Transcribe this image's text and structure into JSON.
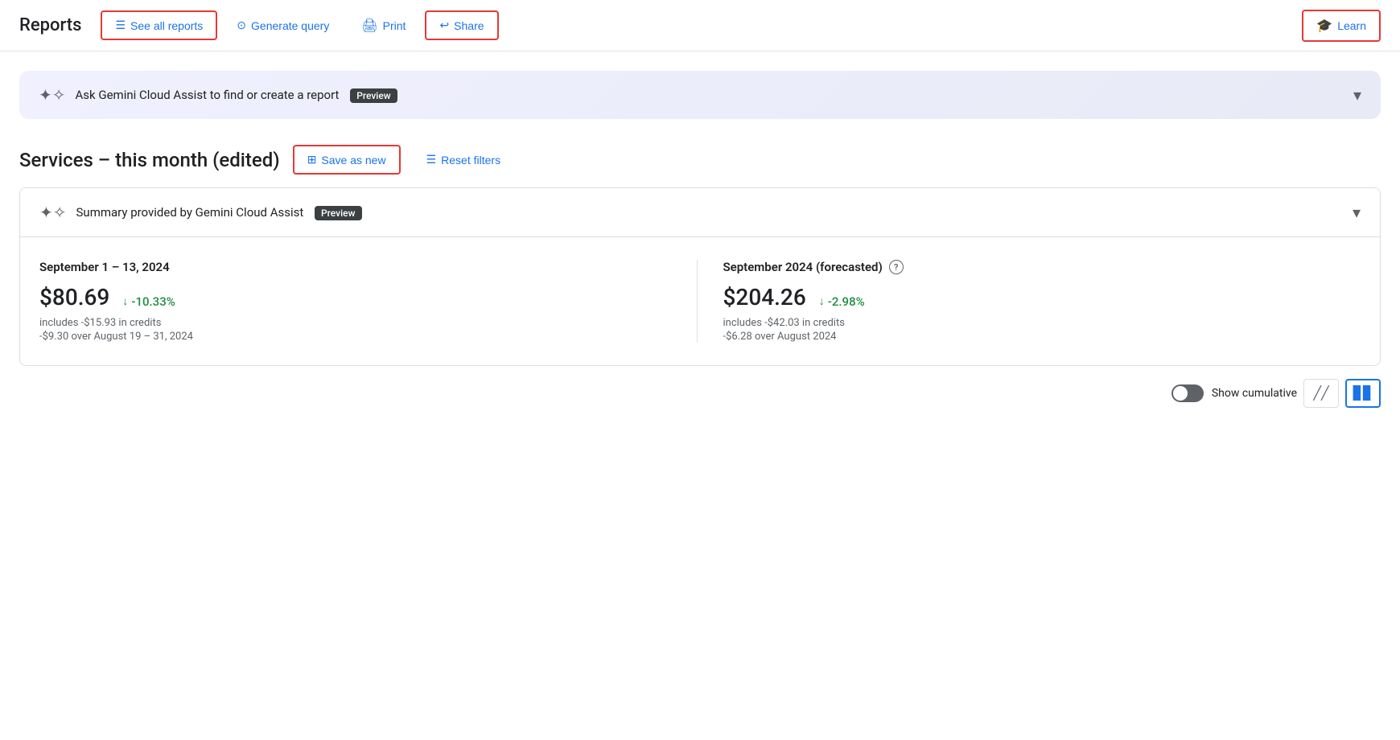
{
  "header": {
    "title": "Reports",
    "see_all_reports_label": "See all reports",
    "generate_query_label": "Generate query",
    "print_label": "Print",
    "share_label": "Share",
    "learn_label": "Learn"
  },
  "gemini_banner": {
    "text": "Ask Gemini Cloud Assist to find or create a report",
    "preview_badge": "Preview"
  },
  "report": {
    "title": "Services – this month (edited)",
    "save_as_new_label": "Save as new",
    "reset_filters_label": "Reset filters"
  },
  "summary": {
    "header_text": "Summary provided by Gemini Cloud Assist",
    "preview_badge": "Preview",
    "col1": {
      "period": "September 1 – 13, 2024",
      "amount": "$80.69",
      "change": "-10.33%",
      "credits": "includes -$15.93 in credits",
      "comparison": "-$9.30 over August 19 – 31, 2024"
    },
    "col2": {
      "period": "September 2024 (forecasted)",
      "amount": "$204.26",
      "change": "-2.98%",
      "credits": "includes -$42.03 in credits",
      "comparison": "-$6.28 over August 2024"
    }
  },
  "bottom_toolbar": {
    "show_cumulative_label": "Show cumulative"
  }
}
